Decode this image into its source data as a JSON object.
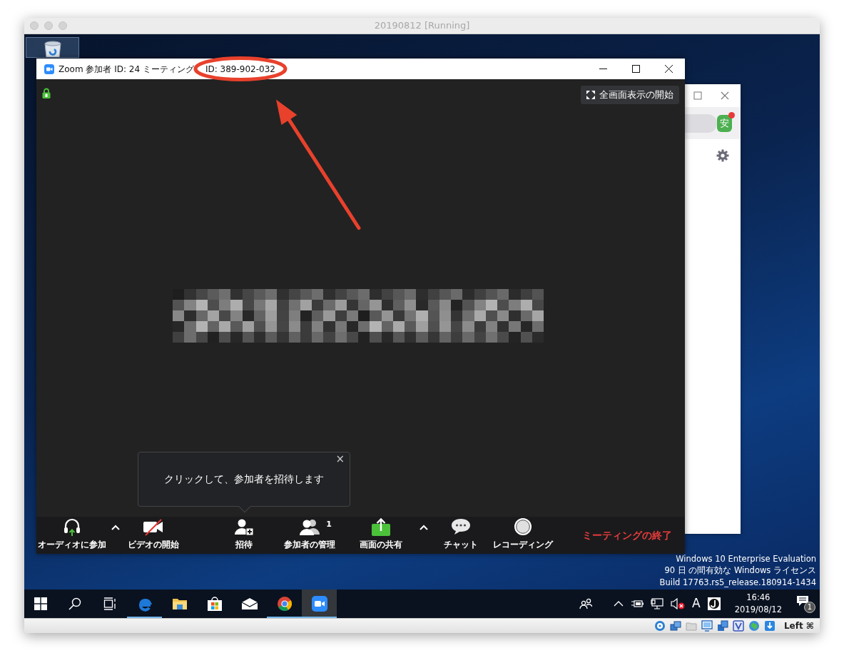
{
  "vm_window": {
    "title": "20190812 [Running]"
  },
  "desktop": {
    "icons": [
      {
        "kind": "recycle-bin",
        "selected": true
      }
    ]
  },
  "zoom_window": {
    "title": "Zoom 参加者 ID: 24 ミーティング",
    "meeting_id": "ID: 389-902-032",
    "encrypted": true,
    "fullscreen_button": "全画面表示の開始",
    "tooltip": {
      "text": "クリックして、参加者を招待します",
      "close": "×"
    },
    "toolbar": [
      {
        "kind": "audio",
        "label": "オーディオに参加",
        "caret": true
      },
      {
        "kind": "video",
        "label": "ビデオの開始",
        "muted": true
      },
      {
        "kind": "invite",
        "label": "招待"
      },
      {
        "kind": "participants",
        "label": "参加者の管理",
        "count": "1"
      },
      {
        "kind": "share",
        "label": "画面の共有",
        "caret": true
      },
      {
        "kind": "chat",
        "label": "チャット"
      },
      {
        "kind": "record",
        "label": "レコーディング"
      }
    ],
    "end_button": "ミーティングの終了"
  },
  "back_window": {
    "avatar": "安",
    "notification": true
  },
  "license_notice": [
    "Windows 10 Enterprise Evaluation",
    "90 日 の間有効な Windows ライセンス",
    "Build 17763.rs5_release.180914-1434"
  ],
  "taskbar": {
    "apps": [
      {
        "kind": "start",
        "running": false,
        "active": false
      },
      {
        "kind": "search",
        "running": false,
        "active": false
      },
      {
        "kind": "task-view",
        "running": false,
        "active": false
      },
      {
        "kind": "edge",
        "running": true,
        "active": false
      },
      {
        "kind": "explorer",
        "running": false,
        "active": false
      },
      {
        "kind": "store",
        "running": false,
        "active": false
      },
      {
        "kind": "mail",
        "running": false,
        "active": false
      },
      {
        "kind": "chrome",
        "running": true,
        "active": false
      },
      {
        "kind": "zoom",
        "running": true,
        "active": true
      }
    ],
    "tray": {
      "volume_muted": true,
      "ime": "A",
      "time": "16:46",
      "date": "2019/08/12",
      "notification_count": "1"
    }
  },
  "vm_status": {
    "host_key": "Left ⌘"
  }
}
